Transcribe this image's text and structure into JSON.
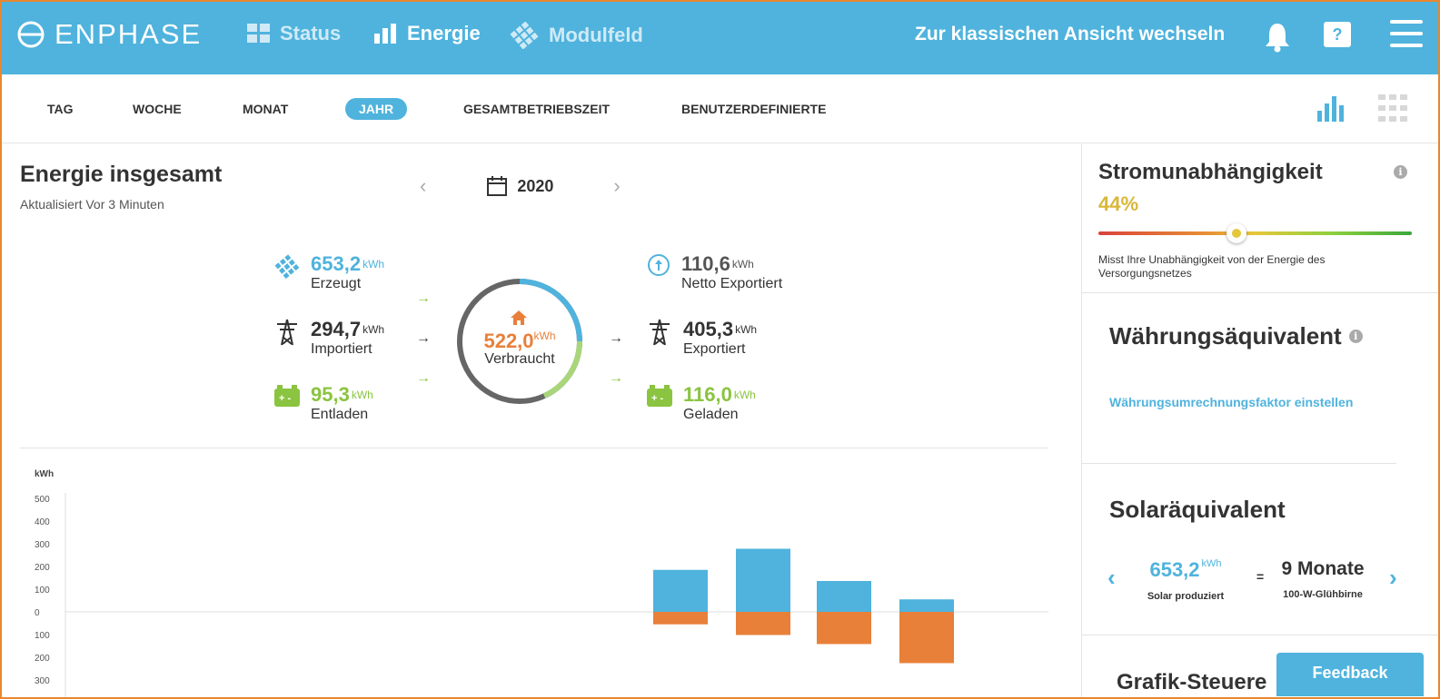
{
  "header": {
    "brand": "ENPHASE",
    "nav": [
      {
        "label": "Status",
        "icon": "grid-icon"
      },
      {
        "label": "Energie",
        "icon": "bar-chart-icon"
      },
      {
        "label": "Modulfeld",
        "icon": "panel-array-icon"
      }
    ],
    "classic_link": "Zur klassischen Ansicht wechseln",
    "help_label": "?"
  },
  "tabs": [
    "TAG",
    "WOCHE",
    "MONAT",
    "JAHR",
    "GESAMTBETRIEBSZEIT",
    "BENUTZERDEFINIERTE"
  ],
  "active_tab": "JAHR",
  "energy": {
    "title": "Energie insgesamt",
    "updated": "Aktualisiert Vor 3 Minuten",
    "year": "2020",
    "produced": {
      "value": "653,2",
      "unit": "kWh",
      "label": "Erzeugt"
    },
    "imported": {
      "value": "294,7",
      "unit": "kWh",
      "label": "Importiert"
    },
    "discharged": {
      "value": "95,3",
      "unit": "kWh",
      "label": "Entladen"
    },
    "consumed": {
      "value": "522,0",
      "unit": "kWh",
      "label": "Verbraucht"
    },
    "net_exported": {
      "value": "110,6",
      "unit": "kWh",
      "label": "Netto Exportiert"
    },
    "exported": {
      "value": "405,3",
      "unit": "kWh",
      "label": "Exportiert"
    },
    "charged": {
      "value": "116,0",
      "unit": "kWh",
      "label": "Geladen"
    }
  },
  "chart_data": {
    "type": "bar",
    "ylabel": "kWh",
    "y_ticks": [
      "500",
      "400",
      "300",
      "200",
      "100",
      "0",
      "100",
      "200",
      "300"
    ],
    "ylim": [
      -300,
      500
    ],
    "series": [
      {
        "values": [
          185,
          278,
          136,
          55
        ]
      },
      {
        "values": [
          -55,
          -102,
          -142,
          -226
        ]
      }
    ],
    "colors": {
      "positive": "#4fb3dd",
      "negative": "#e8803a"
    }
  },
  "independence": {
    "title": "Stromunabhängigkeit",
    "percent": "44%",
    "level": 0.44,
    "description": "Misst Ihre Unabhängigkeit von der Energie des Versorgungsnetzes"
  },
  "currency": {
    "title": "Währungsäquivalent",
    "link": "Währungsumrechnungsfaktor einstellen"
  },
  "solar": {
    "title": "Solaräquivalent",
    "value": "653,2",
    "unit": "kWh",
    "value_label": "Solar produziert",
    "equals": "=",
    "equivalent": "9 Monate",
    "equivalent_label": "100-W-Glühbirne"
  },
  "graph_controls": {
    "title": "Grafik-Steuere"
  },
  "feedback": "Feedback",
  "colors": {
    "header": "#4fb3dd",
    "orange": "#e8803a",
    "green": "#8ac440",
    "yellow": "#d9b73a"
  }
}
